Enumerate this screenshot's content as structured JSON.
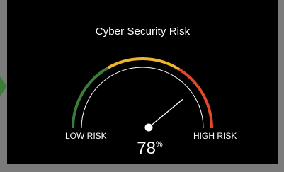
{
  "widget": {
    "title": "Cyber Security Risk",
    "low_label": "LOW RISK",
    "high_label": "HIGH RISK",
    "value": "78",
    "unit": "%",
    "gauge_fraction": 0.78
  },
  "colors": {
    "panel_bg": "#000000",
    "outer_bg": "#7b7b7b",
    "arc_low": "#3c7c3a",
    "arc_mid": "#f0b429",
    "arc_high": "#e2482a",
    "needle": "#ffffff",
    "text": "#ffffff"
  }
}
